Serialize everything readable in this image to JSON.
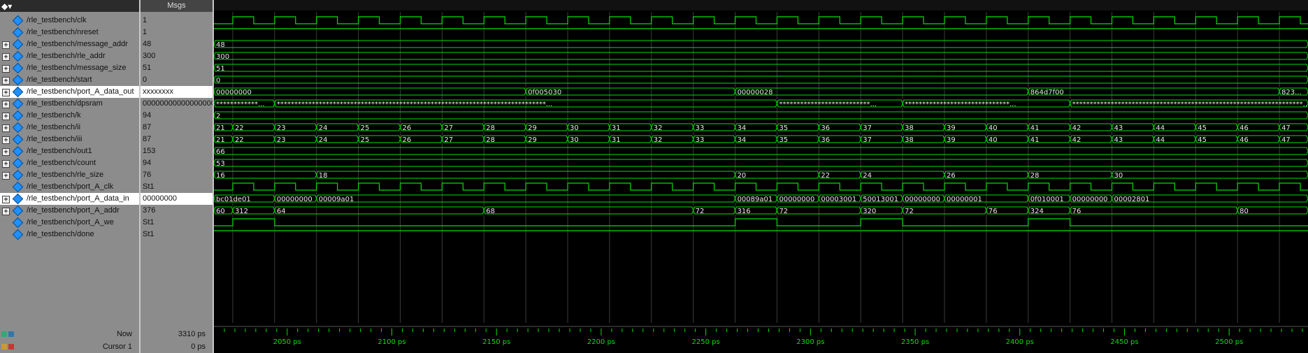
{
  "header": {
    "values_title": "Msgs"
  },
  "toolbar": {
    "icon": "wave-window-menu-icon"
  },
  "colors": {
    "wave": "#00e000",
    "grid": "#3c3c3c",
    "text": "#e8e8e8",
    "tick": "#00e000"
  },
  "signals": [
    {
      "name": "/rle_testbench/clk",
      "value": "1",
      "expandable": false,
      "kind": "clock"
    },
    {
      "name": "/rle_testbench/nreset",
      "value": "1",
      "expandable": false,
      "kind": "high"
    },
    {
      "name": "/rle_testbench/message_addr",
      "value": "48",
      "expandable": true,
      "kind": "bus",
      "segments": [
        {
          "t": 2015,
          "label": "48"
        }
      ]
    },
    {
      "name": "/rle_testbench/rle_addr",
      "value": "300",
      "expandable": true,
      "kind": "bus",
      "segments": [
        {
          "t": 2015,
          "label": "300"
        }
      ]
    },
    {
      "name": "/rle_testbench/message_size",
      "value": "51",
      "expandable": true,
      "kind": "bus",
      "segments": [
        {
          "t": 2015,
          "label": "51"
        }
      ]
    },
    {
      "name": "/rle_testbench/start",
      "value": "0",
      "expandable": true,
      "kind": "bus",
      "segments": [
        {
          "t": 2015,
          "label": "0"
        }
      ]
    },
    {
      "name": "/rle_testbench/port_A_data_out",
      "value": "xxxxxxxx",
      "expandable": true,
      "kind": "bus",
      "selected": true,
      "segments": [
        {
          "t": 2015,
          "label": "00000000"
        },
        {
          "t": 2164,
          "label": "0f005030"
        },
        {
          "t": 2264,
          "label": "00000028"
        },
        {
          "t": 2404,
          "label": "864d7f00"
        },
        {
          "t": 2524,
          "label": "823..."
        }
      ]
    },
    {
      "name": "/rle_testbench/dpsram",
      "value": "000000000000000000",
      "expandable": true,
      "kind": "bus",
      "segments": [
        {
          "t": 2015,
          "label": "************..."
        },
        {
          "t": 2044,
          "label": "*****************************************************************************..."
        },
        {
          "t": 2284,
          "label": "**************************..."
        },
        {
          "t": 2344,
          "label": "******************************..."
        },
        {
          "t": 2424,
          "label": "******************************************************************..."
        }
      ]
    },
    {
      "name": "/rle_testbench/k",
      "value": "94",
      "expandable": true,
      "kind": "bus",
      "segments": [
        {
          "t": 2015,
          "label": "2"
        }
      ]
    },
    {
      "name": "/rle_testbench/ii",
      "value": "87",
      "expandable": true,
      "kind": "bus",
      "segments": [
        {
          "t": 2015,
          "label": "21"
        },
        {
          "t": 2024,
          "label": "22"
        },
        {
          "t": 2044,
          "label": "23"
        },
        {
          "t": 2064,
          "label": "24"
        },
        {
          "t": 2084,
          "label": "25"
        },
        {
          "t": 2104,
          "label": "26"
        },
        {
          "t": 2124,
          "label": "27"
        },
        {
          "t": 2144,
          "label": "28"
        },
        {
          "t": 2164,
          "label": "29"
        },
        {
          "t": 2184,
          "label": "30"
        },
        {
          "t": 2204,
          "label": "31"
        },
        {
          "t": 2224,
          "label": "32"
        },
        {
          "t": 2244,
          "label": "33"
        },
        {
          "t": 2264,
          "label": "34"
        },
        {
          "t": 2284,
          "label": "35"
        },
        {
          "t": 2304,
          "label": "36"
        },
        {
          "t": 2324,
          "label": "37"
        },
        {
          "t": 2344,
          "label": "38"
        },
        {
          "t": 2364,
          "label": "39"
        },
        {
          "t": 2384,
          "label": "40"
        },
        {
          "t": 2404,
          "label": "41"
        },
        {
          "t": 2424,
          "label": "42"
        },
        {
          "t": 2444,
          "label": "43"
        },
        {
          "t": 2464,
          "label": "44"
        },
        {
          "t": 2484,
          "label": "45"
        },
        {
          "t": 2504,
          "label": "46"
        },
        {
          "t": 2524,
          "label": "47"
        }
      ]
    },
    {
      "name": "/rle_testbench/iii",
      "value": "87",
      "expandable": true,
      "kind": "bus",
      "segments": [
        {
          "t": 2015,
          "label": "21"
        },
        {
          "t": 2024,
          "label": "22"
        },
        {
          "t": 2044,
          "label": "23"
        },
        {
          "t": 2064,
          "label": "24"
        },
        {
          "t": 2084,
          "label": "25"
        },
        {
          "t": 2104,
          "label": "26"
        },
        {
          "t": 2124,
          "label": "27"
        },
        {
          "t": 2144,
          "label": "28"
        },
        {
          "t": 2164,
          "label": "29"
        },
        {
          "t": 2184,
          "label": "30"
        },
        {
          "t": 2204,
          "label": "31"
        },
        {
          "t": 2224,
          "label": "32"
        },
        {
          "t": 2244,
          "label": "33"
        },
        {
          "t": 2264,
          "label": "34"
        },
        {
          "t": 2284,
          "label": "35"
        },
        {
          "t": 2304,
          "label": "36"
        },
        {
          "t": 2324,
          "label": "37"
        },
        {
          "t": 2344,
          "label": "38"
        },
        {
          "t": 2364,
          "label": "39"
        },
        {
          "t": 2384,
          "label": "40"
        },
        {
          "t": 2404,
          "label": "41"
        },
        {
          "t": 2424,
          "label": "42"
        },
        {
          "t": 2444,
          "label": "43"
        },
        {
          "t": 2464,
          "label": "44"
        },
        {
          "t": 2484,
          "label": "45"
        },
        {
          "t": 2504,
          "label": "46"
        },
        {
          "t": 2524,
          "label": "47"
        }
      ]
    },
    {
      "name": "/rle_testbench/out1",
      "value": "153",
      "expandable": true,
      "kind": "bus",
      "segments": [
        {
          "t": 2015,
          "label": "66"
        }
      ]
    },
    {
      "name": "/rle_testbench/count",
      "value": "94",
      "expandable": true,
      "kind": "bus",
      "segments": [
        {
          "t": 2015,
          "label": "53"
        }
      ]
    },
    {
      "name": "/rle_testbench/rle_size",
      "value": "76",
      "expandable": true,
      "kind": "bus",
      "segments": [
        {
          "t": 2015,
          "label": "16"
        },
        {
          "t": 2064,
          "label": "18"
        },
        {
          "t": 2264,
          "label": "20"
        },
        {
          "t": 2304,
          "label": "22"
        },
        {
          "t": 2324,
          "label": "24"
        },
        {
          "t": 2364,
          "label": "26"
        },
        {
          "t": 2404,
          "label": "28"
        },
        {
          "t": 2444,
          "label": "30"
        }
      ]
    },
    {
      "name": "/rle_testbench/port_A_clk",
      "value": "St1",
      "expandable": false,
      "kind": "clock"
    },
    {
      "name": "/rle_testbench/port_A_data_in",
      "value": "00000000",
      "expandable": true,
      "kind": "bus",
      "selected": true,
      "segments": [
        {
          "t": 2015,
          "label": "bc01de01"
        },
        {
          "t": 2044,
          "label": "00000000"
        },
        {
          "t": 2064,
          "label": "00009a01"
        },
        {
          "t": 2264,
          "label": "00089a01"
        },
        {
          "t": 2284,
          "label": "00000000"
        },
        {
          "t": 2304,
          "label": "00003001"
        },
        {
          "t": 2324,
          "label": "50013001"
        },
        {
          "t": 2344,
          "label": "00000000"
        },
        {
          "t": 2364,
          "label": "00000001"
        },
        {
          "t": 2404,
          "label": "0f010001"
        },
        {
          "t": 2424,
          "label": "00000000"
        },
        {
          "t": 2444,
          "label": "00002801"
        }
      ]
    },
    {
      "name": "/rle_testbench/port_A_addr",
      "value": "376",
      "expandable": true,
      "kind": "bus",
      "segments": [
        {
          "t": 2015,
          "label": "60"
        },
        {
          "t": 2024,
          "label": "312"
        },
        {
          "t": 2044,
          "label": "64"
        },
        {
          "t": 2144,
          "label": "68"
        },
        {
          "t": 2244,
          "label": "72"
        },
        {
          "t": 2264,
          "label": "316"
        },
        {
          "t": 2284,
          "label": "72"
        },
        {
          "t": 2324,
          "label": "320"
        },
        {
          "t": 2344,
          "label": "72"
        },
        {
          "t": 2384,
          "label": "76"
        },
        {
          "t": 2404,
          "label": "324"
        },
        {
          "t": 2424,
          "label": "76"
        },
        {
          "t": 2504,
          "label": "80"
        }
      ]
    },
    {
      "name": "/rle_testbench/port_A_we",
      "value": "St1",
      "expandable": false,
      "kind": "pulses",
      "pulses": [
        [
          2024,
          2044
        ],
        [
          2264,
          2284
        ],
        [
          2324,
          2344
        ],
        [
          2404,
          2424
        ]
      ]
    },
    {
      "name": "/rle_testbench/done",
      "value": "St1",
      "expandable": false,
      "kind": "high"
    }
  ],
  "timeline": {
    "start": 2015,
    "end": 2536,
    "ticks": [
      "2050 ps",
      "2100 ps",
      "2150 ps",
      "2200 ps",
      "2250 ps",
      "2300 ps",
      "2350 ps",
      "2400 ps",
      "2450 ps",
      "2500 ps"
    ],
    "tick_values": [
      2050,
      2100,
      2150,
      2200,
      2250,
      2300,
      2350,
      2400,
      2450,
      2500
    ],
    "clock_period": 20,
    "clock_first_rise": 2024
  },
  "footer": {
    "now_label": "Now",
    "now_value": "3310 ps",
    "cursor_label": "Cursor 1",
    "cursor_value": "0 ps"
  }
}
